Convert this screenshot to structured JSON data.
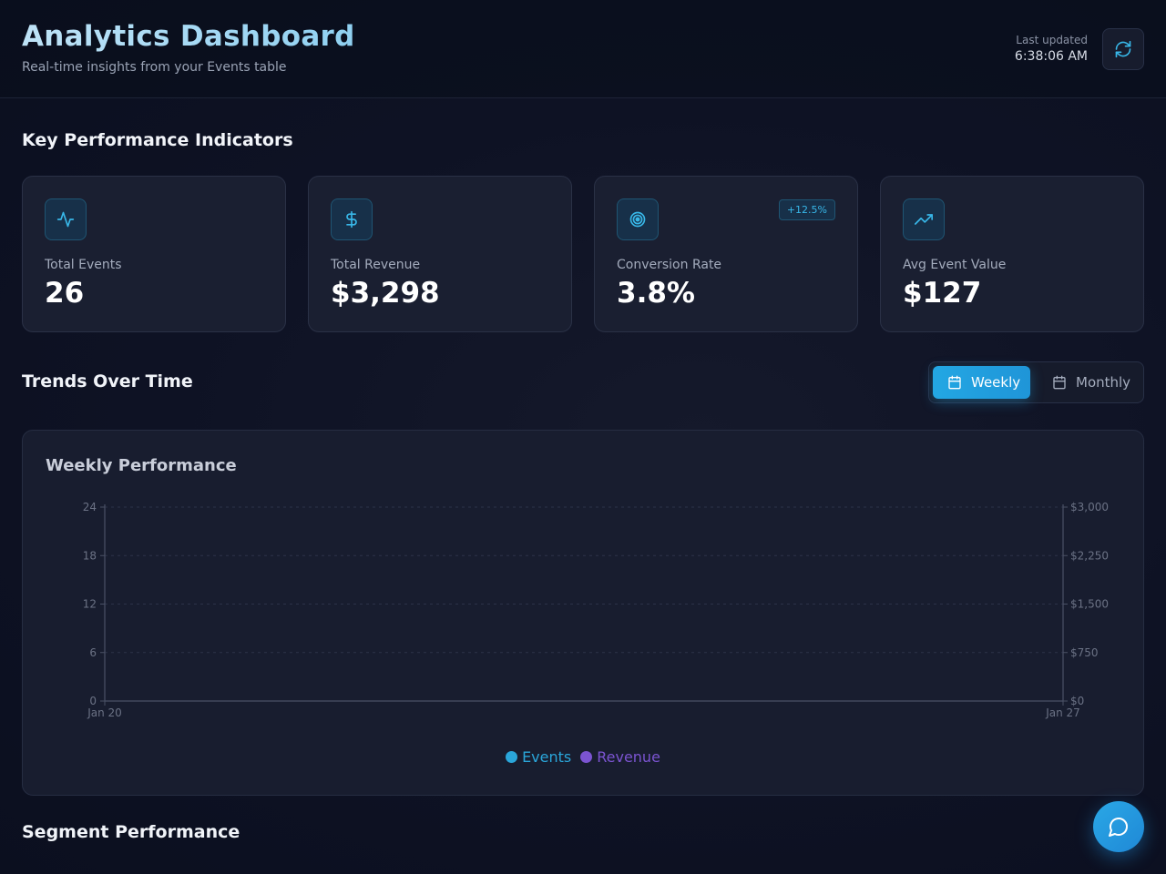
{
  "header": {
    "title": "Analytics Dashboard",
    "subtitle": "Real-time insights from your Events table",
    "last_updated_label": "Last updated",
    "last_updated_time": "6:38:06 AM",
    "refresh_icon": "refresh-icon"
  },
  "kpi_section": {
    "title": "Key Performance Indicators",
    "cards": [
      {
        "label": "Total Events",
        "value": "26",
        "icon": "activity-icon"
      },
      {
        "label": "Total Revenue",
        "value": "$3,298",
        "icon": "dollar-icon"
      },
      {
        "label": "Conversion Rate",
        "value": "3.8%",
        "icon": "target-icon",
        "badge": "+12.5%"
      },
      {
        "label": "Avg Event Value",
        "value": "$127",
        "icon": "trending-up-icon"
      }
    ]
  },
  "trends_section": {
    "title": "Trends Over Time",
    "toggle": {
      "weekly_label": "Weekly",
      "monthly_label": "Monthly",
      "selected": "Weekly"
    }
  },
  "chart_data": {
    "type": "line",
    "title": "Weekly Performance",
    "x": [
      "Jan 20",
      "Jan 27"
    ],
    "y_left_ticks": [
      "0",
      "6",
      "12",
      "18",
      "24"
    ],
    "y_right_ticks": [
      "$0",
      "$750",
      "$1,500",
      "$2,250",
      "$3,000"
    ],
    "ylim_left": [
      0,
      24
    ],
    "ylim_right": [
      0,
      3000
    ],
    "grid": true,
    "legend_position": "bottom",
    "series": [
      {
        "name": "Events",
        "color": "#2aa6da",
        "values": []
      },
      {
        "name": "Revenue",
        "color": "#7b54d1",
        "values": []
      }
    ]
  },
  "segment_section": {
    "title": "Segment Performance"
  },
  "colors": {
    "accent": "#23a7e3",
    "events": "#2aa6da",
    "revenue": "#7b54d1"
  },
  "chat_icon": "chat-bubble-icon"
}
